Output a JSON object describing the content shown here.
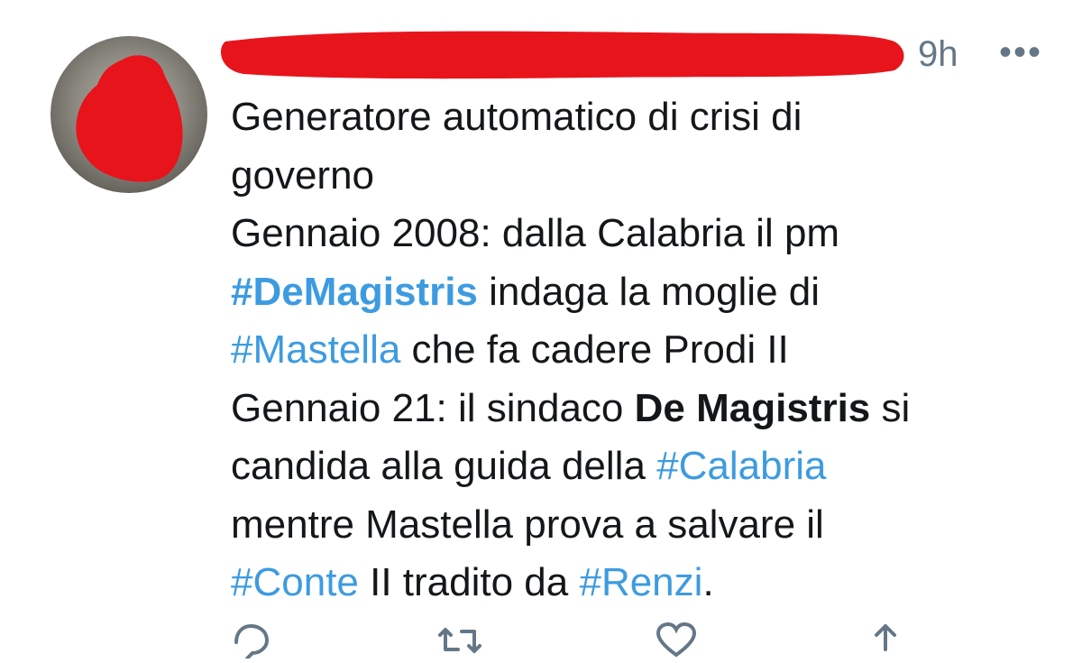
{
  "tweet": {
    "timestamp": "9h",
    "more_label": "•••",
    "lines": [
      [
        {
          "t": "Generatore automatico di crisi di"
        }
      ],
      [
        {
          "t": "governo"
        }
      ],
      [
        {
          "t": "Gennaio 2008: dalla Calabria il pm"
        }
      ],
      [
        {
          "t": "#DeMagistris",
          "style": "hashtag-bold"
        },
        {
          "t": " indaga la moglie di"
        }
      ],
      [
        {
          "t": "#Mastella",
          "style": "hashtag"
        },
        {
          "t": " che fa cadere Prodi II"
        }
      ],
      [
        {
          "t": "Gennaio 21: il sindaco "
        },
        {
          "t": "De Magistris",
          "style": "bold"
        },
        {
          "t": " si"
        }
      ],
      [
        {
          "t": "candida alla guida della "
        },
        {
          "t": "#Calabria",
          "style": "hashtag"
        }
      ],
      [
        {
          "t": "mentre Mastella prova a salvare il"
        }
      ],
      [
        {
          "t": "#Conte",
          "style": "hashtag"
        },
        {
          "t": " II tradito da "
        },
        {
          "t": "#Renzi",
          "style": "hashtag"
        },
        {
          "t": "."
        }
      ]
    ]
  },
  "icons": {
    "avatar": "avatar-redacted",
    "reply": "reply-icon",
    "retweet": "retweet-icon",
    "like": "heart-icon",
    "share": "share-icon"
  },
  "colors": {
    "hashtag": "#3d9be0",
    "meta": "#657786",
    "redaction": "#e8141c",
    "text": "#14171a"
  }
}
